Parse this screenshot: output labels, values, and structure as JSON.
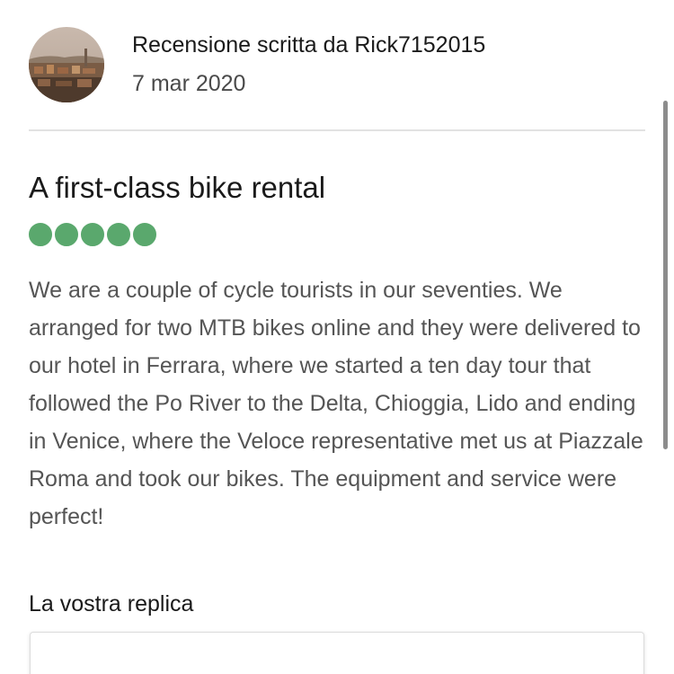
{
  "review": {
    "author_line": "Recensione scritta da Rick7152015",
    "date": "7 mar 2020",
    "avatar_icon": "user-avatar-photo-cityscape",
    "title": "A first-class bike rental",
    "rating": 5,
    "rating_max": 5,
    "rating_color": "#5aa86d",
    "body": "We are a couple of cycle tourists in our seventies. We arranged for two MTB bikes online and they were delivered to our hotel in Ferrara, where we started a ten day tour that followed the Po River to the Delta, Chioggia, Lido and ending in Venice, where the Veloce representative met us at Piazzale Roma and took our bikes. The equipment and service were perfect!"
  },
  "reply": {
    "label": "La vostra replica",
    "value": ""
  }
}
